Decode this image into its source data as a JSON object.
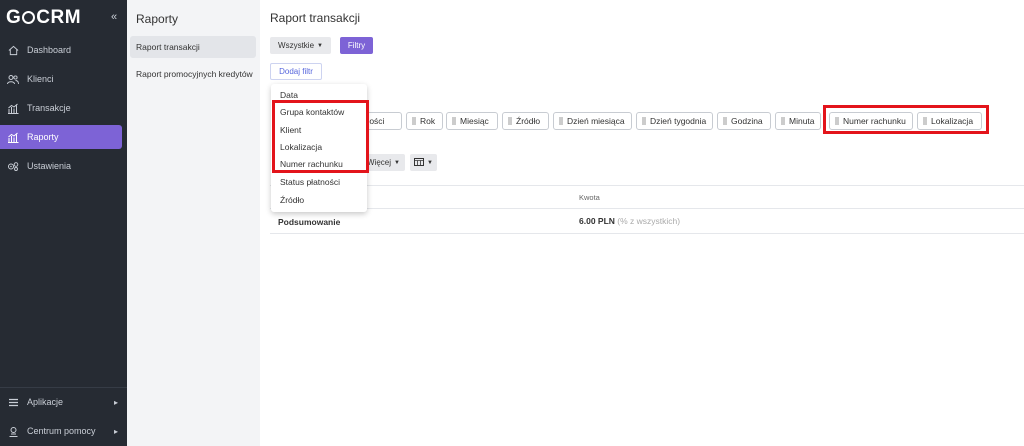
{
  "app": {
    "logo_prefix": "G",
    "logo_suffix": "CRM",
    "collapse_icon": "double-chevron-left-icon"
  },
  "sidebar": {
    "items": [
      {
        "label": "Dashboard",
        "icon": "home-icon"
      },
      {
        "label": "Klienci",
        "icon": "users-icon"
      },
      {
        "label": "Transakcje",
        "icon": "chart-icon"
      },
      {
        "label": "Raporty",
        "icon": "chart-icon",
        "active": true
      },
      {
        "label": "Ustawienia",
        "icon": "gears-icon"
      }
    ],
    "bottom": [
      {
        "label": "Aplikacje",
        "icon": "grid-icon"
      },
      {
        "label": "Centrum pomocy",
        "icon": "help-icon"
      }
    ]
  },
  "subnav": {
    "title": "Raporty",
    "items": [
      "Raport transakcji",
      "Raport promocyjnych kredytów"
    ]
  },
  "main": {
    "title": "Raport transakcji",
    "filter_select": "Wszystkie",
    "filter_button": "Filtry",
    "add_filter": "Dodaj filtr",
    "chips": [
      "…atności",
      "Rok",
      "Miesiąc",
      "Źródło",
      "Dzień miesiąca",
      "Dzień tygodnia",
      "Godzina",
      "Minuta",
      "Numer rachunku",
      "Lokalizacja"
    ],
    "more_button": "Więcej",
    "columns_button_icon": "columns-icon",
    "table": {
      "header_amount": "Kwota",
      "summary_label": "Podsumowanie",
      "summary_value": "6.00 PLN",
      "summary_pct": "(% z wszystkich)"
    }
  },
  "dropdown": {
    "items": [
      "Data",
      "Grupa kontaktów",
      "Klient",
      "Lokalizacja",
      "Numer rachunku",
      "Status płatności",
      "Źródło"
    ]
  },
  "colors": {
    "sidebar": "#262b33",
    "accent": "#7d63d6",
    "highlight": "#e3141b"
  }
}
